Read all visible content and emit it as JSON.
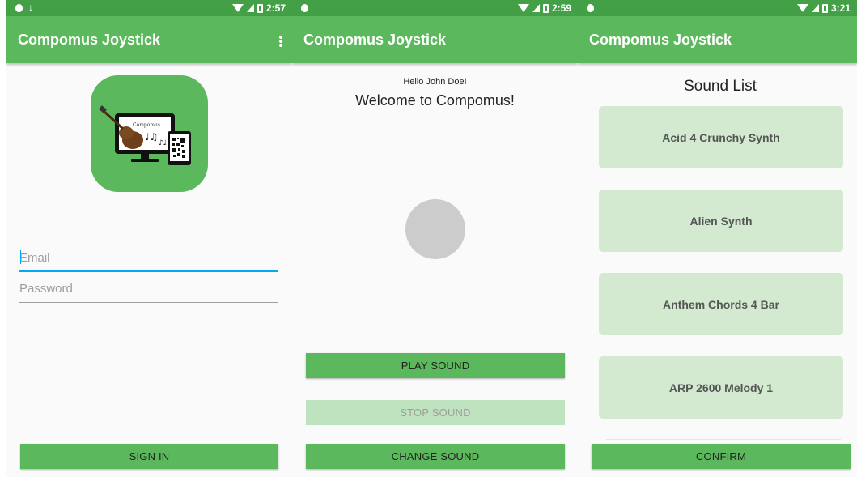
{
  "screens": [
    {
      "status": {
        "time": "2:57"
      },
      "app_title": "Compomus Joystick",
      "logo_text": "Compomus",
      "email_placeholder": "Email",
      "password_placeholder": "Password",
      "sign_in_label": "SIGN IN"
    },
    {
      "status": {
        "time": "2:59"
      },
      "app_title": "Compomus Joystick",
      "hello": "Hello John Doe!",
      "welcome": "Welcome to Compomus!",
      "play_label": "PLAY SOUND",
      "stop_label": "STOP SOUND",
      "change_label": "CHANGE SOUND"
    },
    {
      "status": {
        "time": "3:21"
      },
      "app_title": "Compomus Joystick",
      "heading": "Sound List",
      "sounds": [
        "Acid 4 Crunchy Synth",
        "Alien Synth",
        "Anthem Chords 4 Bar",
        "ARP 2600 Melody 1"
      ],
      "confirm_label": "CONFIRM"
    }
  ],
  "colors": {
    "status_bar": "#43a047",
    "app_bar": "#5cb85c",
    "button": "#5cb85c",
    "button_disabled": "#bfe3bf",
    "sound_item": "#d3ead1",
    "joystick": "#cccccc",
    "focus_underline": "#03a9f4"
  },
  "icons": [
    "status-dot-icon",
    "download-icon",
    "wifi-icon",
    "signal-icon",
    "battery-icon",
    "more-vert-icon",
    "guitar-monitor-logo-icon"
  ]
}
